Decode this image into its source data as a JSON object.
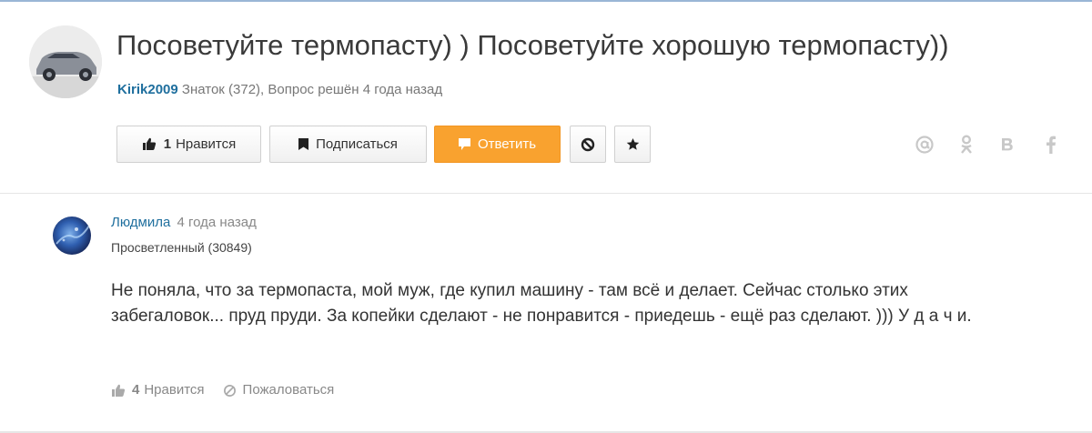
{
  "question": {
    "title": "Посоветуйте термопасту) ) Посоветуйте хорошую термопасту))",
    "author": "Kirik2009",
    "author_rank": "Знаток (372),",
    "status": "Вопрос решён 4 года назад",
    "avatar_icon": "car-photo"
  },
  "actions": {
    "like_count": "1",
    "like_label": "Нравится",
    "subscribe_label": "Подписаться",
    "answer_label": "Ответить",
    "block_icon": "block-icon",
    "star_icon": "star-icon",
    "accent_color": "#f9a22f"
  },
  "share": [
    "at-icon",
    "odnoklassniki-icon",
    "vk-icon",
    "facebook-icon"
  ],
  "answer": {
    "author": "Людмила",
    "time": "4 года назад",
    "rank": "Просветленный (30849)",
    "text": "Не поняла, что за термопаста, мой муж, где купил машину - там всё и делает. Сейчас столько этих забегаловок... пруд пруди. За копейки сделают - не понравится - приедешь - ещё раз сделают. ))) У д а ч и.",
    "like_count": "4",
    "like_label": "Нравится",
    "report_label": "Пожаловаться"
  }
}
